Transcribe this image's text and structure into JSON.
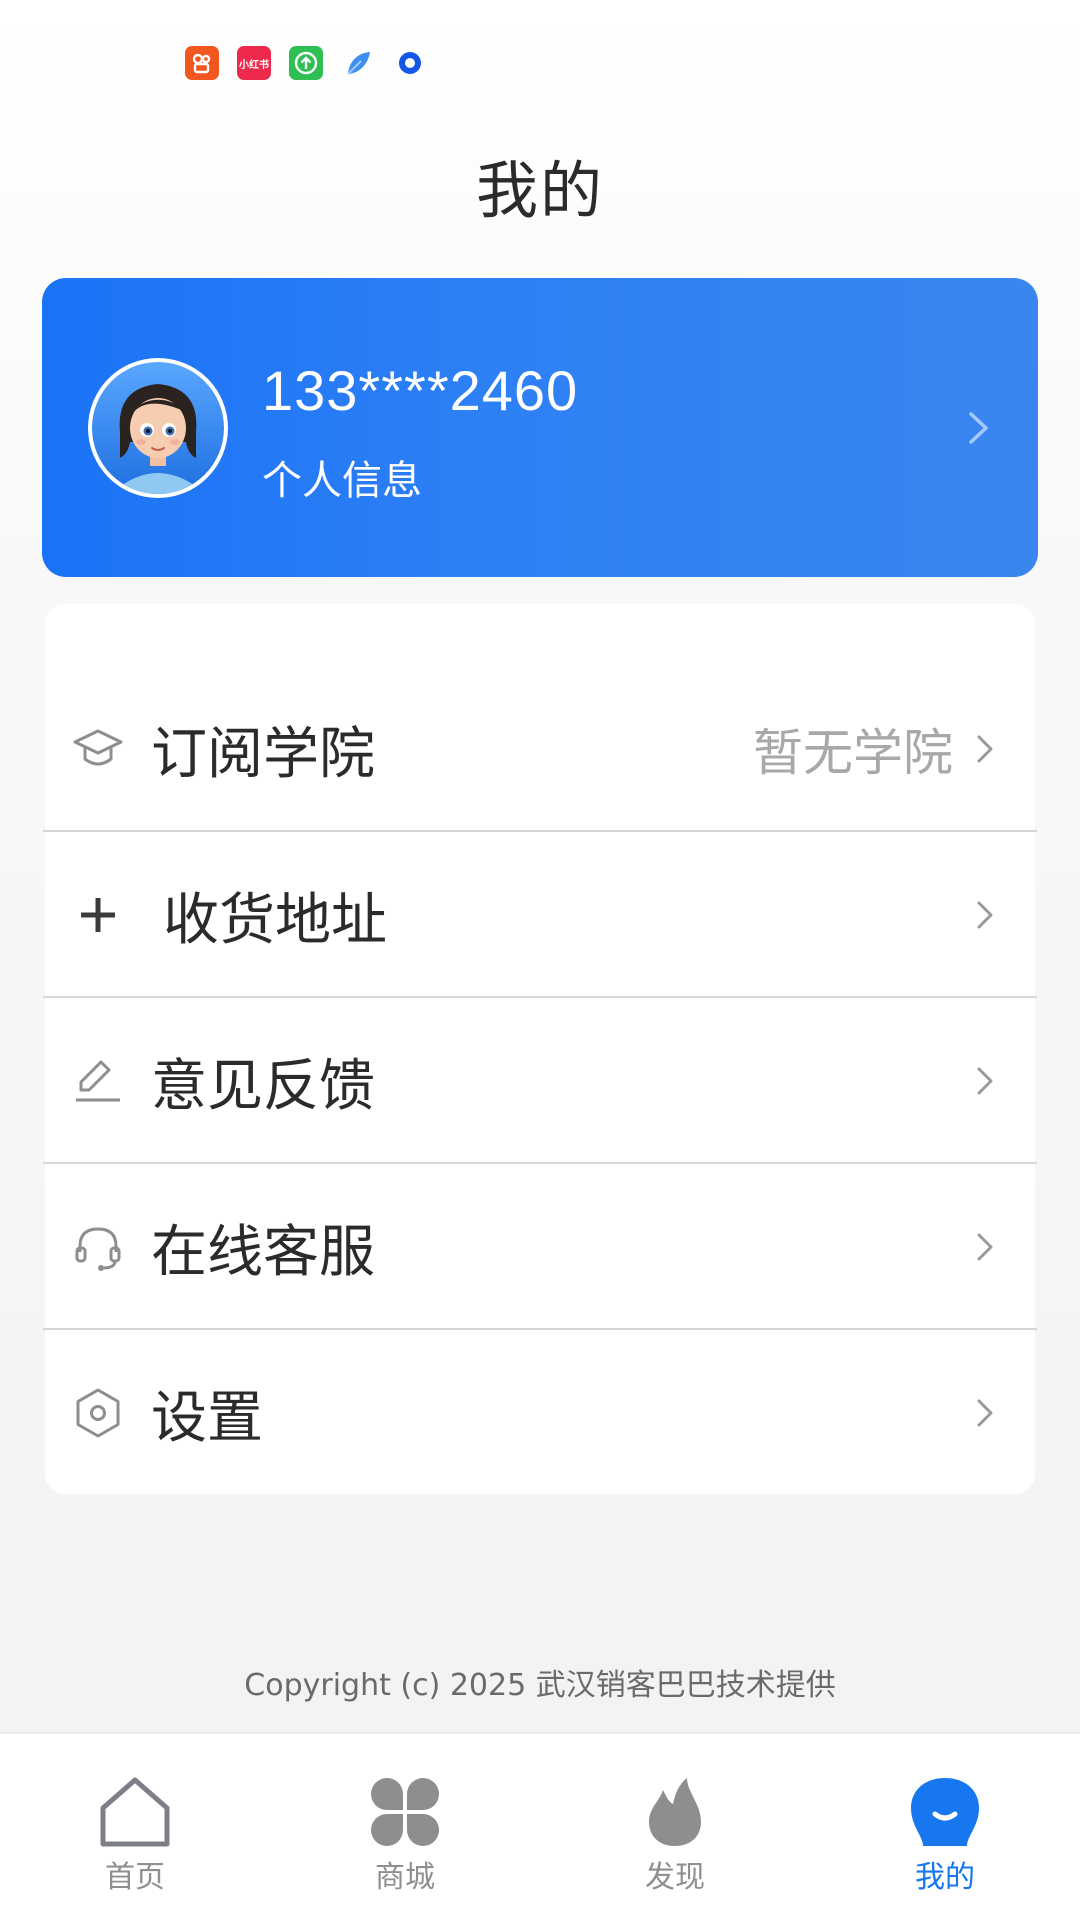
{
  "status_bar": {
    "apps": [
      {
        "icon": "kuaishou-icon",
        "color": "#f2571f"
      },
      {
        "icon": "xiaohongshu-icon",
        "label": "小红书",
        "color": "#ee2a4c"
      },
      {
        "icon": "upload-app-icon",
        "color": "#2fbe52"
      },
      {
        "icon": "feather-app-icon",
        "color": "#3d8ef0"
      },
      {
        "icon": "ring-app-icon",
        "color": "#1456e6"
      }
    ]
  },
  "header": {
    "title": "我的"
  },
  "profile": {
    "phone": "133****2460",
    "subtitle": "个人信息",
    "avatar_icon": "cartoon-girl-avatar"
  },
  "menu": {
    "items": [
      {
        "icon": "graduation-cap-icon",
        "label": "订阅学院",
        "value": "暂无学院"
      },
      {
        "icon": "plus-icon",
        "label": "收货地址",
        "value": ""
      },
      {
        "icon": "edit-pen-icon",
        "label": "意见反馈",
        "value": ""
      },
      {
        "icon": "headset-icon",
        "label": "在线客服",
        "value": ""
      },
      {
        "icon": "hexagon-settings-icon",
        "label": "设置",
        "value": ""
      }
    ]
  },
  "footer": {
    "copyright": "Copyright (c) 2025 武汉销客巴巴技术提供"
  },
  "tab_bar": {
    "tabs": [
      {
        "label": "首页",
        "icon": "home-icon",
        "active": false
      },
      {
        "label": "商城",
        "icon": "clover-grid-icon",
        "active": false
      },
      {
        "label": "发现",
        "icon": "flame-icon",
        "active": false
      },
      {
        "label": "我的",
        "icon": "smile-bubble-icon",
        "active": true
      }
    ]
  },
  "colors": {
    "accent": "#1677ee",
    "card_gradient_start": "#1a73f6",
    "card_gradient_end": "#3a86ef",
    "text_primary": "#2b2b2b",
    "text_muted": "#a8a8a8",
    "tab_inactive": "#8f8f8f"
  }
}
